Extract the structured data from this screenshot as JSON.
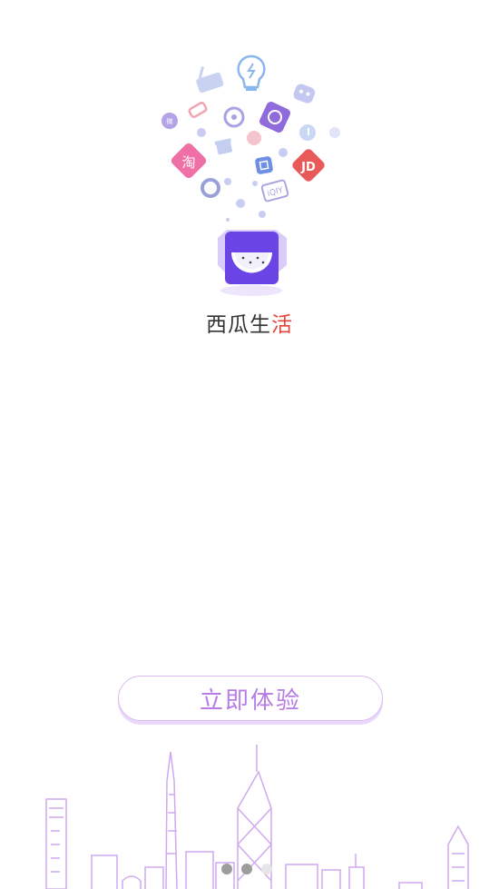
{
  "app": {
    "name_part1": "西瓜生",
    "name_part2": "活"
  },
  "cta": {
    "label": "立即体验"
  },
  "icons": [
    "basket-icon",
    "lightbulb-icon",
    "robot-icon",
    "weibo-icon",
    "tag-icon",
    "compass-icon",
    "sticker-icon",
    "music-icon",
    "taobao-icon",
    "gift-icon",
    "jd-icon",
    "phone-icon",
    "qq-icon",
    "iqiyi-icon",
    "watermelon-app-icon"
  ],
  "pager": {
    "count": 3,
    "active_index": 1
  },
  "colors": {
    "accent": "#b77ce6",
    "button_border": "#d9b9f2",
    "box_purple": "#7b4df0",
    "taobao_pink": "#ef6fa7",
    "jd_red": "#e85a5a",
    "skyline_stroke": "#cfa9ef"
  }
}
